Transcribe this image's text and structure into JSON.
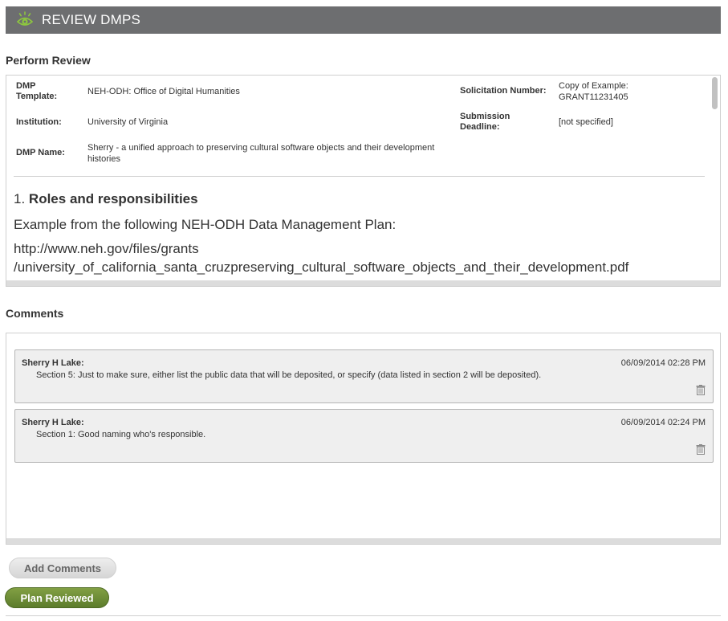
{
  "header": {
    "title": "REVIEW DMPS",
    "icon": "eye-icon",
    "icon_color": "#8dc63f",
    "background": "#6d6e70"
  },
  "review": {
    "section_title": "Perform Review",
    "meta": {
      "template_label": "DMP Template:",
      "template_value": "NEH-ODH: Office of Digital Humanities",
      "solicitation_label": "Solicitation Number:",
      "solicitation_value": "Copy of Example: GRANT11231405",
      "institution_label": "Institution:",
      "institution_value": "University of Virginia",
      "deadline_label": "Submission Deadline:",
      "deadline_value": "[not specified]",
      "name_label": "DMP Name:",
      "name_value": "Sherry - a unified approach to preserving cultural software objects and their development histories"
    },
    "question": {
      "number": "1.",
      "title": "Roles and responsibilities",
      "text": "Example from the following NEH-ODH Data Management Plan:",
      "link_line1": "http://www.neh.gov/files/grants",
      "link_line2": "/university_of_california_santa_cruzpreserving_cultural_software_objects_and_their_development.pdf"
    }
  },
  "comments": {
    "section_title": "Comments",
    "items": [
      {
        "author": "Sherry H Lake:",
        "date": "06/09/2014 02:28 PM",
        "text": "Section 5: Just to make sure, either list the public data that will be deposited, or specify (data listed in section 2 will be deposited)."
      },
      {
        "author": "Sherry H Lake:",
        "date": "06/09/2014 02:24 PM",
        "text": "Section 1: Good naming who's responsible."
      }
    ]
  },
  "actions": {
    "add_comments": "Add Comments",
    "plan_reviewed": "Plan Reviewed",
    "accent_color": "#6e8e36"
  }
}
